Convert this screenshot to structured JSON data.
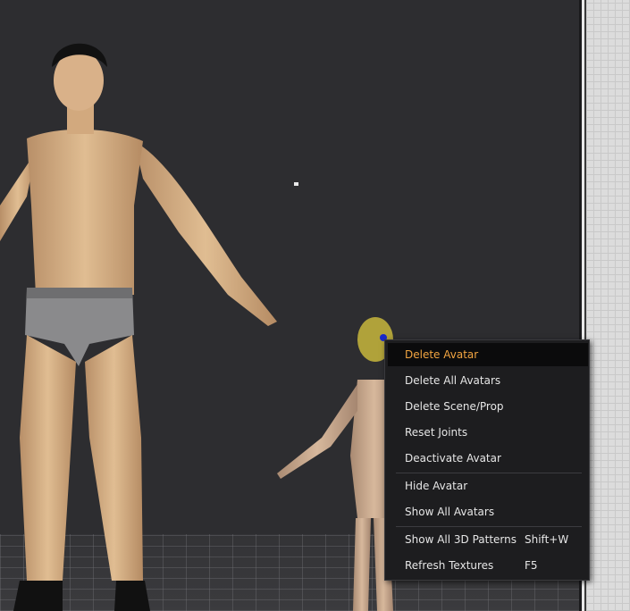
{
  "viewport": {
    "background": "#2d2d30"
  },
  "avatars": [
    {
      "name": "adult-male-avatar"
    },
    {
      "name": "child-avatar",
      "selected": true
    }
  ],
  "context_menu": {
    "items": [
      {
        "label": "Delete Avatar",
        "shortcut": "",
        "active": true
      },
      {
        "label": "Delete All Avatars",
        "shortcut": ""
      },
      {
        "label": "Delete Scene/Prop",
        "shortcut": ""
      },
      {
        "label": "Reset Joints",
        "shortcut": ""
      },
      {
        "label": "Deactivate Avatar",
        "shortcut": ""
      },
      {
        "label": "Hide Avatar",
        "shortcut": ""
      },
      {
        "label": "Show All Avatars",
        "shortcut": ""
      },
      {
        "label": "Show All 3D Patterns",
        "shortcut": "Shift+W"
      },
      {
        "label": "Refresh Textures",
        "shortcut": "F5"
      }
    ],
    "highlight_color": "#f2a541"
  }
}
